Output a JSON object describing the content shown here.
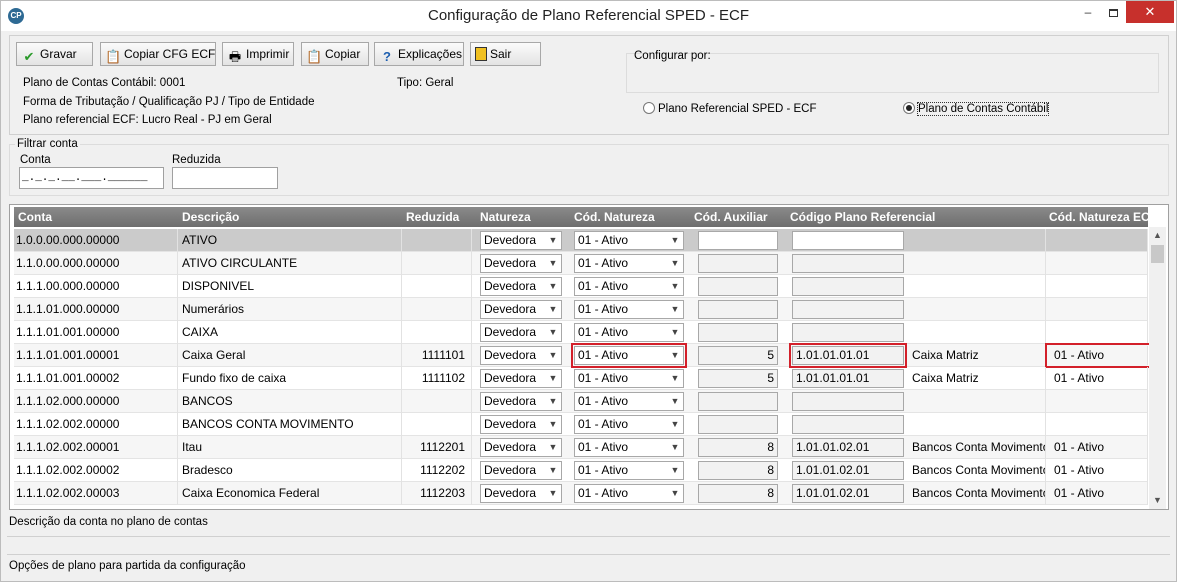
{
  "window": {
    "title": "Configuração de Plano Referencial SPED - ECF",
    "icon_text": "CP",
    "min_label": "–",
    "close_label": "✕"
  },
  "toolbar": {
    "buttons": [
      {
        "label": "Gravar",
        "icon": "check-icon"
      },
      {
        "label": "Copiar CFG ECF",
        "icon": "copy-icon"
      },
      {
        "label": "Imprimir",
        "icon": "printer-icon"
      },
      {
        "label": "Copiar",
        "icon": "copy-icon"
      },
      {
        "label": "Explicações",
        "icon": "question-icon"
      },
      {
        "label": "Sair",
        "icon": "exit-door-icon"
      }
    ]
  },
  "info": {
    "plano_contas": "Plano de Contas Contábil:  0001",
    "tipo": "Tipo: Geral",
    "forma_tributacao": "Forma de Tributação / Qualificação PJ / Tipo de Entidade",
    "plano_referencial": "Plano referencial ECF:   Lucro Real - PJ em Geral"
  },
  "configurar": {
    "label": "Configurar por:",
    "option_sped": "Plano Referencial SPED - ECF",
    "option_contabil": "Plano de Contas Contábil",
    "selected": "Plano de Contas Contábil"
  },
  "filter": {
    "title": "Filtrar conta",
    "conta_label": "Conta",
    "conta_mask": "_._._.__.___.______",
    "reduzida_label": "Reduzida",
    "reduzida_value": ""
  },
  "grid": {
    "headers": [
      "Conta",
      "Descrição",
      "Reduzida",
      "Natureza",
      "Cód. Natureza",
      "Cód. Auxiliar",
      "Código Plano Referencial",
      "Cód. Natureza ECF"
    ],
    "rows": [
      {
        "conta": "1.0.0.00.000.00000",
        "descricao": "ATIVO",
        "reduzida": "",
        "natureza": "Devedora",
        "cod_natureza": "01 - Ativo",
        "cod_auxiliar": "",
        "codigo_ref": "",
        "ref_desc": "",
        "cod_natureza_ecf": ""
      },
      {
        "conta": "1.1.0.00.000.00000",
        "descricao": "ATIVO CIRCULANTE",
        "reduzida": "",
        "natureza": "Devedora",
        "cod_natureza": "01 - Ativo",
        "cod_auxiliar": "",
        "codigo_ref": "",
        "ref_desc": "",
        "cod_natureza_ecf": ""
      },
      {
        "conta": "1.1.1.00.000.00000",
        "descricao": "DISPONIVEL",
        "reduzida": "",
        "natureza": "Devedora",
        "cod_natureza": "01 - Ativo",
        "cod_auxiliar": "",
        "codigo_ref": "",
        "ref_desc": "",
        "cod_natureza_ecf": ""
      },
      {
        "conta": "1.1.1.01.000.00000",
        "descricao": "Numerários",
        "reduzida": "",
        "natureza": "Devedora",
        "cod_natureza": "01 - Ativo",
        "cod_auxiliar": "",
        "codigo_ref": "",
        "ref_desc": "",
        "cod_natureza_ecf": ""
      },
      {
        "conta": "1.1.1.01.001.00000",
        "descricao": "CAIXA",
        "reduzida": "",
        "natureza": "Devedora",
        "cod_natureza": "01 - Ativo",
        "cod_auxiliar": "",
        "codigo_ref": "",
        "ref_desc": "",
        "cod_natureza_ecf": ""
      },
      {
        "conta": "1.1.1.01.001.00001",
        "descricao": "Caixa Geral",
        "reduzida": "1111101",
        "natureza": "Devedora",
        "cod_natureza": "01 - Ativo",
        "cod_auxiliar": "5",
        "codigo_ref": "1.01.01.01.01",
        "ref_desc": "Caixa Matriz",
        "cod_natureza_ecf": "01 - Ativo"
      },
      {
        "conta": "1.1.1.01.001.00002",
        "descricao": "Fundo fixo de caixa",
        "reduzida": "1111102",
        "natureza": "Devedora",
        "cod_natureza": "01 - Ativo",
        "cod_auxiliar": "5",
        "codigo_ref": "1.01.01.01.01",
        "ref_desc": "Caixa Matriz",
        "cod_natureza_ecf": "01 - Ativo"
      },
      {
        "conta": "1.1.1.02.000.00000",
        "descricao": "BANCOS",
        "reduzida": "",
        "natureza": "Devedora",
        "cod_natureza": "01 - Ativo",
        "cod_auxiliar": "",
        "codigo_ref": "",
        "ref_desc": "",
        "cod_natureza_ecf": ""
      },
      {
        "conta": "1.1.1.02.002.00000",
        "descricao": "BANCOS CONTA MOVIMENTO",
        "reduzida": "",
        "natureza": "Devedora",
        "cod_natureza": "01 - Ativo",
        "cod_auxiliar": "",
        "codigo_ref": "",
        "ref_desc": "",
        "cod_natureza_ecf": ""
      },
      {
        "conta": "1.1.1.02.002.00001",
        "descricao": "Itau",
        "reduzida": "1112201",
        "natureza": "Devedora",
        "cod_natureza": "01 - Ativo",
        "cod_auxiliar": "8",
        "codigo_ref": "1.01.01.02.01",
        "ref_desc": "Bancos Conta Movimento -",
        "cod_natureza_ecf": "01 - Ativo"
      },
      {
        "conta": "1.1.1.02.002.00002",
        "descricao": "Bradesco",
        "reduzida": "1112202",
        "natureza": "Devedora",
        "cod_natureza": "01 - Ativo",
        "cod_auxiliar": "8",
        "codigo_ref": "1.01.01.02.01",
        "ref_desc": "Bancos Conta Movimento -",
        "cod_natureza_ecf": "01 - Ativo"
      },
      {
        "conta": "1.1.1.02.002.00003",
        "descricao": "Caixa Economica Federal",
        "reduzida": "1112203",
        "natureza": "Devedora",
        "cod_natureza": "01 - Ativo",
        "cod_auxiliar": "8",
        "codigo_ref": "1.01.01.02.01",
        "ref_desc": "Bancos Conta Movimento -",
        "cod_natureza_ecf": "01 - Ativo"
      }
    ]
  },
  "status": {
    "descricao": "Descrição da conta no plano de contas",
    "opcoes": "Opções de plano para partida da configuração"
  },
  "colors": {
    "highlight": "#d3202a",
    "header_bg": "#7a7a7a",
    "selected_row": "#cbcbcb"
  }
}
